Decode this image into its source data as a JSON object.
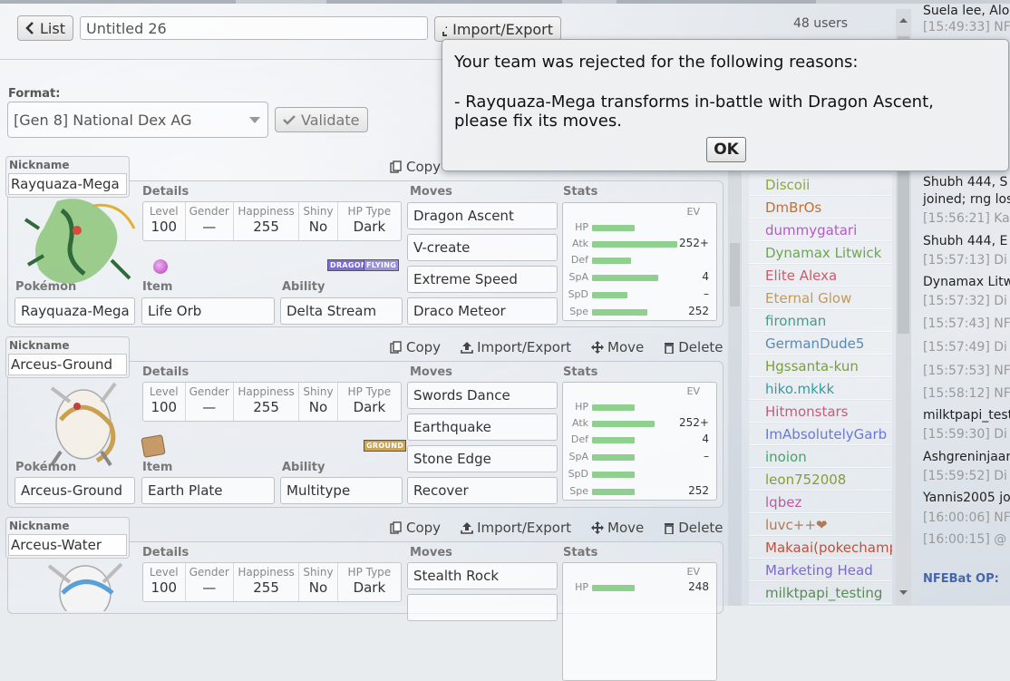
{
  "header": {
    "list_button": "List",
    "team_name": "Untitled 26",
    "import_export": "Import/Export",
    "format_label": "Format:",
    "format_value": "[Gen 8] National Dex AG",
    "validate": "Validate"
  },
  "labels": {
    "nickname": "Nickname",
    "details": "Details",
    "moves": "Moves",
    "stats": "Stats",
    "pokemon": "Pokémon",
    "item": "Item",
    "ability": "Ability",
    "level": "Level",
    "gender": "Gender",
    "happiness": "Happiness",
    "shiny": "Shiny",
    "hp_type": "HP Type",
    "ev": "EV"
  },
  "actions": {
    "copy": "Copy",
    "import_export": "Import/Export",
    "move": "Move",
    "delete": "Delete"
  },
  "stat_names": [
    "HP",
    "Atk",
    "Def",
    "SpA",
    "SpD",
    "Spe"
  ],
  "sets": [
    {
      "nickname": "Rayquaza-Mega",
      "pokemon": "Rayquaza-Mega",
      "item": "Life Orb",
      "ability": "Delta Stream",
      "level": "100",
      "gender": "—",
      "happiness": "255",
      "shiny": "No",
      "hp_type": "Dark",
      "types": [
        "DRAGON",
        "FLYING"
      ],
      "moves": [
        "Dragon Ascent",
        "V-create",
        "Extreme Speed",
        "Draco Meteor"
      ],
      "stat_fill": [
        0.36,
        0.72,
        0.33,
        0.56,
        0.3,
        0.47
      ],
      "evs": [
        "",
        "252+",
        "",
        "4",
        "–",
        "252"
      ]
    },
    {
      "nickname": "Arceus-Ground",
      "pokemon": "Arceus-Ground",
      "item": "Earth Plate",
      "ability": "Multitype",
      "level": "100",
      "gender": "—",
      "happiness": "255",
      "shiny": "No",
      "hp_type": "Dark",
      "types": [
        "GROUND"
      ],
      "moves": [
        "Swords Dance",
        "Earthquake",
        "Stone Edge",
        "Recover"
      ],
      "stat_fill": [
        0.36,
        0.53,
        0.36,
        0.36,
        0.36,
        0.36
      ],
      "evs": [
        "",
        "252+",
        "4",
        "–",
        "",
        "252"
      ]
    },
    {
      "nickname": "Arceus-Water",
      "pokemon": "",
      "item": "",
      "ability": "",
      "level": "100",
      "gender": "—",
      "happiness": "255",
      "shiny": "No",
      "hp_type": "Dark",
      "types": [],
      "moves": [
        "Stealth Rock"
      ],
      "stat_fill": [
        0.36
      ],
      "evs": [
        "248"
      ]
    }
  ],
  "userlist": {
    "count": "48 users",
    "users": [
      {
        "name": "Discoii",
        "color": "#8ba83a"
      },
      {
        "name": "DmBrOs",
        "color": "#c0703a"
      },
      {
        "name": "dummygatari",
        "color": "#b55ac8"
      },
      {
        "name": "Dynamax Litwick",
        "color": "#6aa84f"
      },
      {
        "name": "Elite Alexa",
        "color": "#d05a6a"
      },
      {
        "name": "Eternal Glow",
        "color": "#c29a5a"
      },
      {
        "name": "fironman",
        "color": "#4a9a8a"
      },
      {
        "name": "GermanDude5",
        "color": "#5a8ab0"
      },
      {
        "name": "Hgssanta-kun",
        "color": "#7aa03a"
      },
      {
        "name": "hiko.mkkk",
        "color": "#3a9aa0"
      },
      {
        "name": "Hitmonstars",
        "color": "#c85a7a"
      },
      {
        "name": "ImAbsolutelyGarb",
        "color": "#6a7ad0"
      },
      {
        "name": "inoion",
        "color": "#4aa06a"
      },
      {
        "name": "leon752008",
        "color": "#8a9a3a"
      },
      {
        "name": "lqbez",
        "color": "#c05aa0"
      },
      {
        "name": "luvc++❤",
        "color": "#b07a5a"
      },
      {
        "name": "Makaai(pokechamp",
        "color": "#c0503a"
      },
      {
        "name": "Marketing Head",
        "color": "#7a6ac8"
      },
      {
        "name": "milktpapi_testing",
        "color": "#5a8a5a"
      }
    ]
  },
  "chat": {
    "lines": [
      {
        "text": "Suela lee, Alo",
        "ts": false
      },
      {
        "text": "[15:49:33] NF",
        "ts": true
      },
      {
        "text": "Shubh 444, S",
        "ts": false
      },
      {
        "text": "joined; rng los",
        "ts": false
      },
      {
        "text": "[15:56:21] Ka",
        "ts": true
      },
      {
        "text": "Shubh 444, E",
        "ts": false
      },
      {
        "text": "[15:57:13] Di",
        "ts": true
      },
      {
        "text": "Dynamax Litw",
        "ts": false
      },
      {
        "text": "[15:57:32] Di",
        "ts": true
      },
      {
        "text": "[15:57:43] NF",
        "ts": true
      },
      {
        "text": "[15:57:49] Di",
        "ts": true
      },
      {
        "text": "[15:57:53] NF",
        "ts": true
      },
      {
        "text": "[15:58:12] NF",
        "ts": true
      },
      {
        "text": "milktpapi_test",
        "ts": false
      },
      {
        "text": "[15:59:30] Di",
        "ts": true
      },
      {
        "text": "Ashgreninjaar",
        "ts": false
      },
      {
        "text": "[15:59:52] Di",
        "ts": true
      },
      {
        "text": "Yannis2005 jo",
        "ts": false
      },
      {
        "text": "[16:00:06] NF",
        "ts": true
      },
      {
        "text": "[16:00:15] @",
        "ts": true
      },
      {
        "text": "NFEBat OP:",
        "ts": false
      }
    ]
  },
  "dialog": {
    "line1": "Your team was rejected for the following reasons:",
    "line2": "- Rayquaza-Mega transforms in-battle with Dragon Ascent,",
    "line3": "please fix its moves.",
    "ok": "OK"
  },
  "colors": {
    "stat_bar": "#8fd08f",
    "dragon": "#7a6adb",
    "flying": "#9a90e0",
    "ground": "#c9a55a",
    "accent_text_blue": "#4466aa"
  }
}
